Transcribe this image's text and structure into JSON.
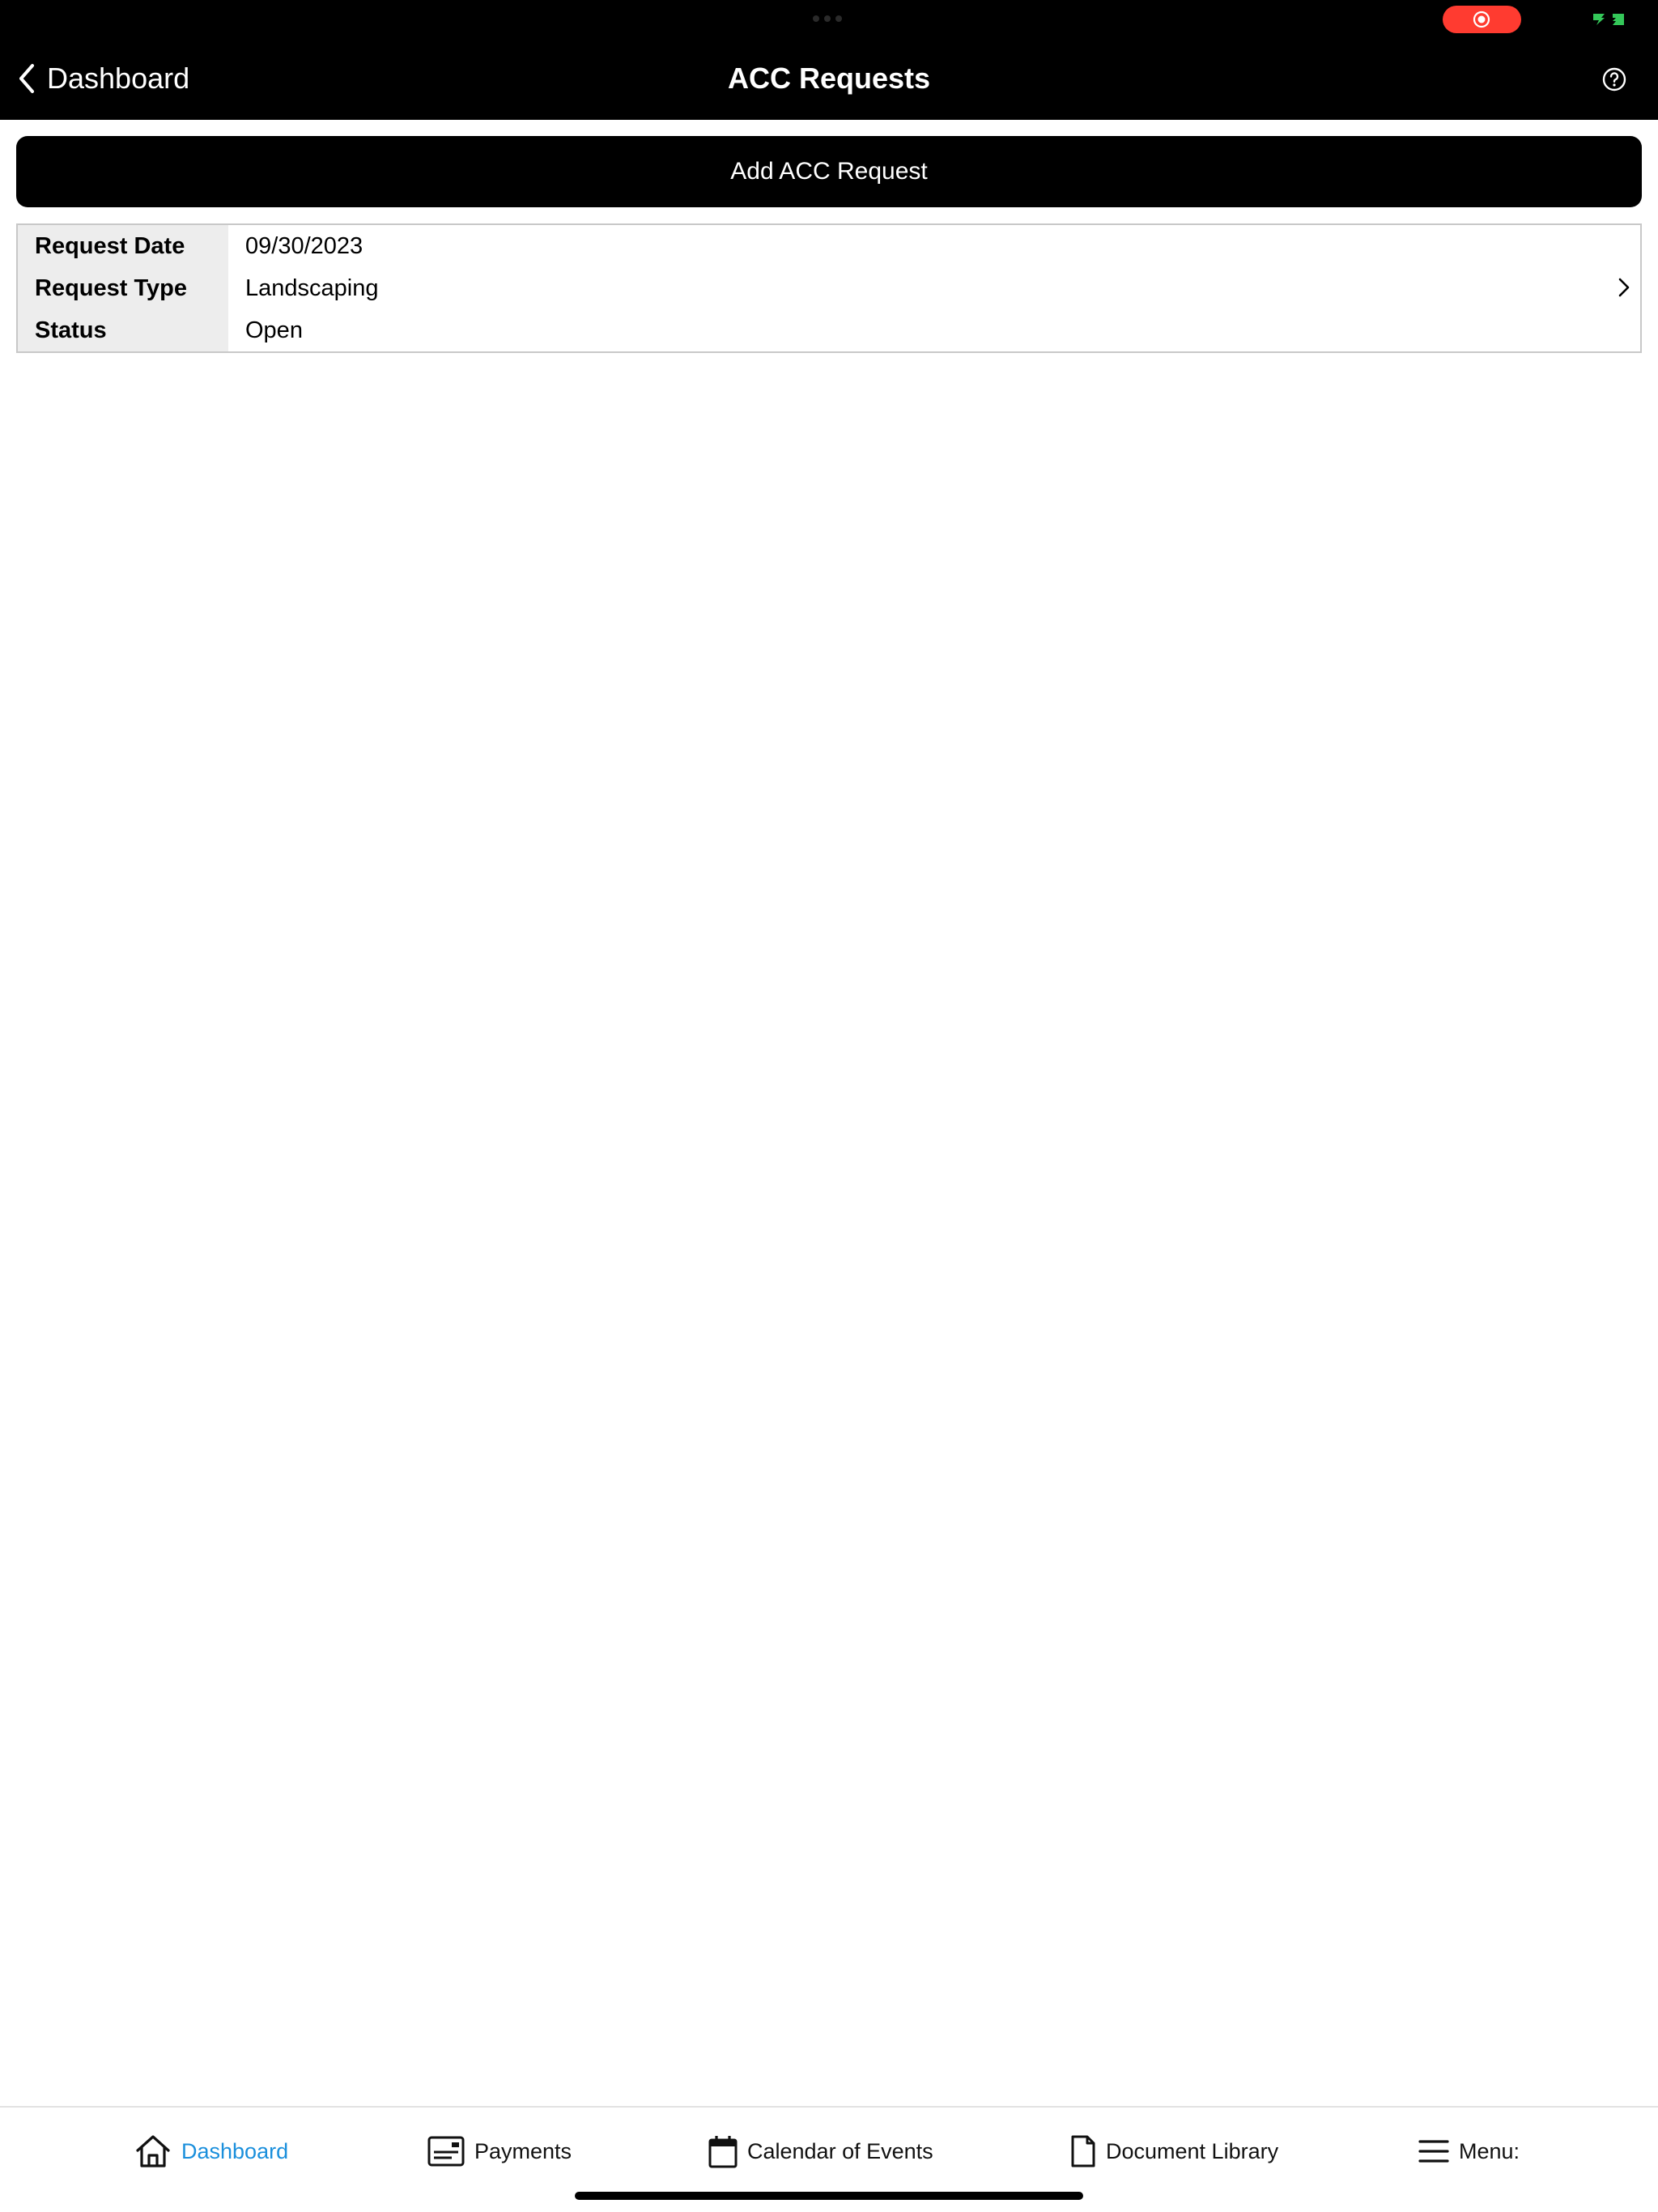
{
  "header": {
    "back_label": "Dashboard",
    "title": "ACC Requests"
  },
  "status_bar": {
    "recording_color": "#ff3b30",
    "battery_color": "#34c759"
  },
  "actions": {
    "add_label": "Add ACC Request"
  },
  "requests": [
    {
      "fields": [
        {
          "label": "Request Date",
          "value": "09/30/2023"
        },
        {
          "label": "Request Type",
          "value": "Landscaping"
        },
        {
          "label": "Status",
          "value": "Open"
        }
      ]
    }
  ],
  "tabbar": {
    "active_color": "#1a8fdc",
    "items": [
      {
        "label": "Dashboard",
        "icon": "home-icon",
        "active": true
      },
      {
        "label": "Payments",
        "icon": "payment-card-icon",
        "active": false
      },
      {
        "label": "Calendar of Events",
        "icon": "calendar-icon",
        "active": false
      },
      {
        "label": "Document Library",
        "icon": "document-icon",
        "active": false
      },
      {
        "label": "Menu:",
        "icon": "hamburger-menu-icon",
        "active": false
      }
    ]
  }
}
